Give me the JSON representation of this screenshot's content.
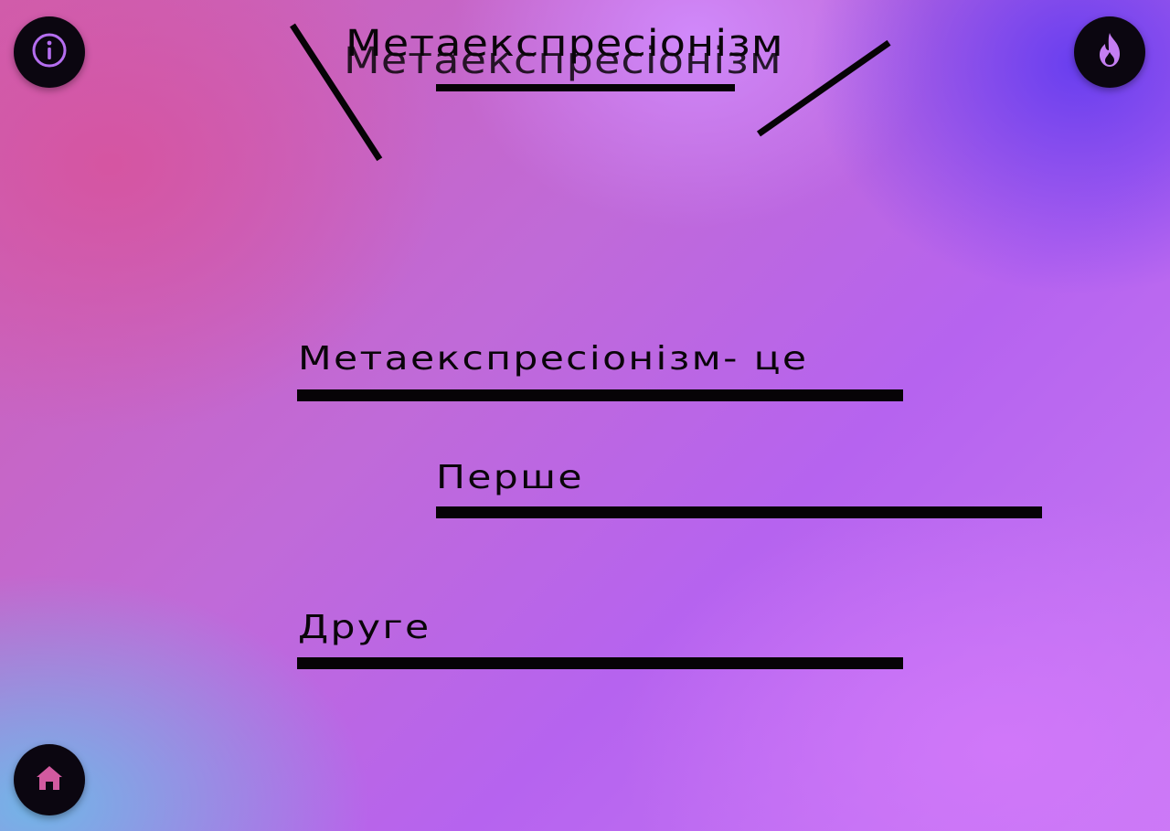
{
  "header": {
    "title": "Метаекспресіонізм"
  },
  "buttons": {
    "info": {
      "icon": "info-icon",
      "color": "#b56ef0"
    },
    "fire": {
      "icon": "fire-icon",
      "color": "#c47ef2"
    },
    "home": {
      "icon": "home-icon",
      "color": "#d25a9f"
    }
  },
  "content": {
    "definition_label": "Метаекспресіонізм- це",
    "first_label": "Перше",
    "second_label": "Друге"
  },
  "colors": {
    "ink": "#060306",
    "pink": "#cf5fae",
    "violet": "#6a3cf0",
    "sky": "#6eb9e8"
  }
}
